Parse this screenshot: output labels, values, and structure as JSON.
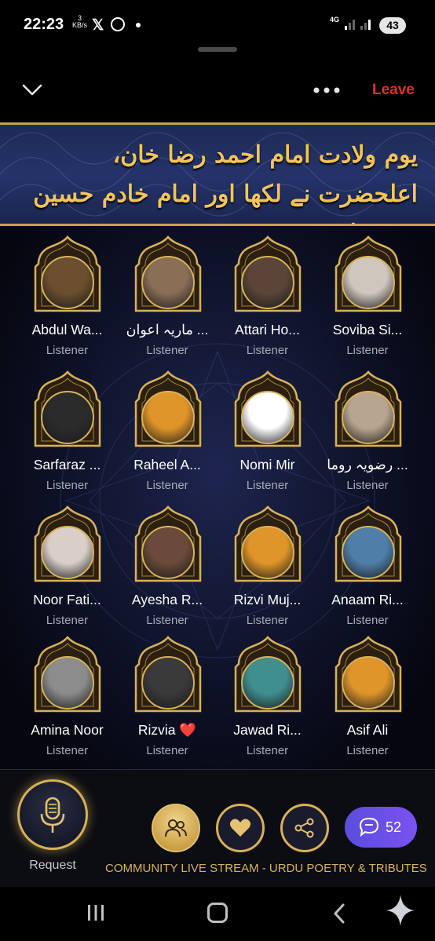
{
  "status": {
    "time": "22:23",
    "speed_value": "3",
    "speed_unit": "KB/s",
    "x_icon": "x-icon",
    "network": "4G",
    "battery": "43"
  },
  "header": {
    "leave_label": "Leave"
  },
  "banner": {
    "title": "یوم ولادت امام احمد رضا خان، اعلحضرت نے لکھا اور امام خادم حسین نے پڑھا"
  },
  "participants": [
    {
      "name": "Abdul Wa...",
      "role": "Listener",
      "color": "#6b4f2f"
    },
    {
      "name": "ماریہ اعوان ...",
      "role": "Listener",
      "color": "#8a6e56"
    },
    {
      "name": "Attari Ho...",
      "role": "Listener",
      "color": "#5b4538"
    },
    {
      "name": "Soviba Si...",
      "role": "Listener",
      "color": "#cfc6bd"
    },
    {
      "name": "Sarfaraz ...",
      "role": "Listener",
      "color": "#2b2b2b"
    },
    {
      "name": "Raheel A...",
      "role": "Listener",
      "color": "#e0952a"
    },
    {
      "name": "Nomi Mir",
      "role": "Listener",
      "color": "#ffffff"
    },
    {
      "name": "رضویہ روما ...",
      "role": "Listener",
      "color": "#b8a58f"
    },
    {
      "name": "Noor Fati...",
      "role": "Listener",
      "color": "#d9cfc8"
    },
    {
      "name": "Ayesha R...",
      "role": "Listener",
      "color": "#6a4a3a"
    },
    {
      "name": "Rizvi Muj...",
      "role": "Listener",
      "color": "#e0952a"
    },
    {
      "name": "Anaam Ri...",
      "role": "Listener",
      "color": "#4f7fa8"
    },
    {
      "name": "Amina Noor",
      "role": "Listener",
      "color": "#8c8c8c"
    },
    {
      "name": "Rizvia ❤️",
      "role": "Listener",
      "color": "#3a3a3a"
    },
    {
      "name": "Jawad Ri...",
      "role": "Listener",
      "color": "#3f8f8f"
    },
    {
      "name": "Asif Ali",
      "role": "Listener",
      "color": "#e0952a"
    }
  ],
  "controls": {
    "request_label": "Request",
    "chat_count": "52",
    "caption": "COMMUNITY LIVE STREAM - URDU POETRY & TRIBUTES"
  },
  "colors": {
    "accent_gold": "#d7b155",
    "leave_red": "#e0302e",
    "chat_purple": "#6a4fe8"
  }
}
